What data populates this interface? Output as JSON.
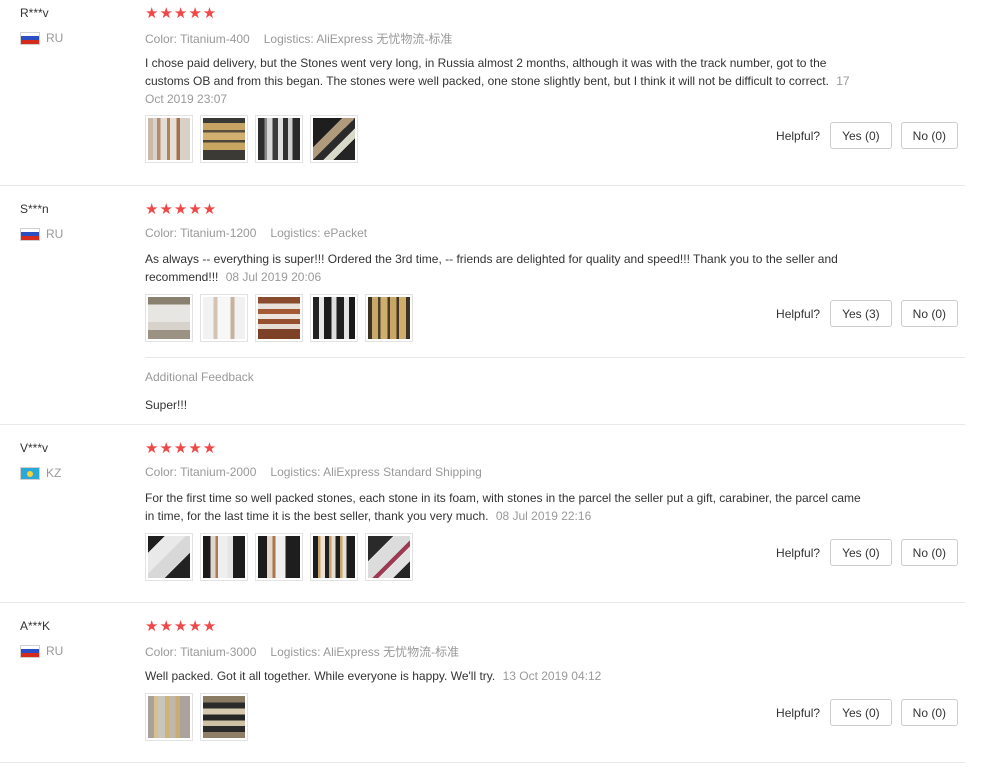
{
  "helpful_label": "Helpful?",
  "star_glyphs": "★★★★★",
  "reviews": [
    {
      "user": "R***v",
      "country": "RU",
      "stars": 5,
      "color": "Color: Titanium-400",
      "logistics": "Logistics: AliExpress 无忧物流-标准",
      "text": "I chose paid delivery, but the Stones went very long, in Russia almost 2 months, although it was with the track number, got to the customs OB and from this began. The stones were well packed, one stone slightly bent, but I think it will not be difficult to correct.",
      "date": "17 Oct 2019 23:07",
      "yes": "Yes (0)",
      "no": "No (0)",
      "photos": 4
    },
    {
      "user": "S***n",
      "country": "RU",
      "stars": 5,
      "color": "Color: Titanium-1200",
      "logistics": "Logistics: ePacket",
      "text": "As always -- everything is super!!! Ordered the 3rd time, -- friends are delighted for quality and speed!!! Thank you to the seller and recommend!!!",
      "date": "08 Jul 2019 20:06",
      "yes": "Yes (3)",
      "no": "No (0)",
      "photos": 5,
      "additional_label": "Additional Feedback",
      "additional_text": "Super!!!"
    },
    {
      "user": "V***v",
      "country": "KZ",
      "stars": 5,
      "color": "Color: Titanium-2000",
      "logistics": "Logistics: AliExpress Standard Shipping",
      "text": "For the first time so well packed stones, each stone in its foam, with stones in the parcel the seller put a gift, carabiner, the parcel came in time, for the last time it is the best seller, thank you very much.",
      "date": "08 Jul 2019 22:16",
      "yes": "Yes (0)",
      "no": "No (0)",
      "photos": 5
    },
    {
      "user": "A***K",
      "country": "RU",
      "stars": 5,
      "color": "Color: Titanium-3000",
      "logistics": "Logistics: AliExpress 无忧物流-标准",
      "text": "Well packed. Got it all together. While everyone is happy. We'll try.",
      "date": "13 Oct 2019 04:12",
      "yes": "Yes (0)",
      "no": "No (0)",
      "photos": 2
    }
  ]
}
